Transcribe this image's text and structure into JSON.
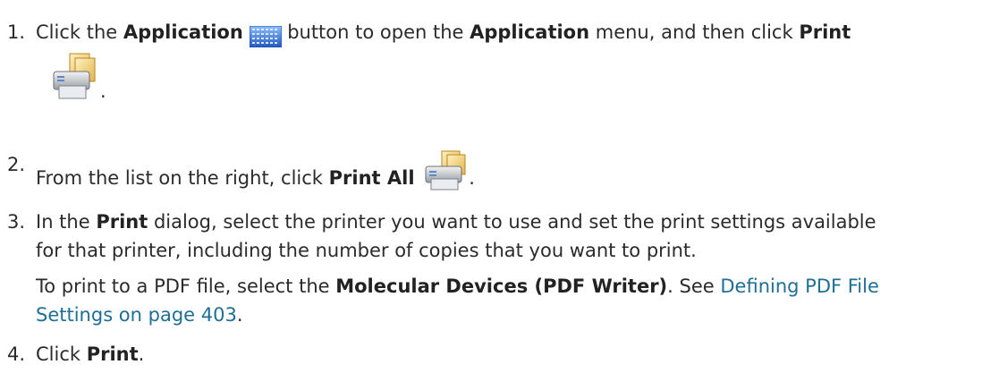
{
  "steps": [
    {
      "number": "1.",
      "t1": "Click the ",
      "b1": "Application",
      "t2": " button to open the ",
      "b2": "Application",
      "t3": " menu, and then click ",
      "b3": "Print",
      "t4": "."
    },
    {
      "number": "2.",
      "t1": "From the list on the right, click ",
      "b1": "Print All",
      "t2": "."
    },
    {
      "number": "3.",
      "t1": "In the ",
      "b1": "Print",
      "t2": " dialog, select the printer you want to use and set the print settings available",
      "line2": "for that printer, including the number of copies that you want to print.",
      "note_t1": "To print to a PDF file, select the ",
      "note_b1": "Molecular Devices (PDF Writer)",
      "note_t2": ". See ",
      "link_line1": "Defining PDF File",
      "link_line2": "Settings on page 403",
      "note_t3": "."
    },
    {
      "number": "4.",
      "t1": "Click ",
      "b1": "Print",
      "t2": "."
    }
  ],
  "icons": {
    "application": "application-grid-icon",
    "print": "printer-icon",
    "print_all": "print-all-icon"
  },
  "colors": {
    "text": "#2b2b2b",
    "link": "#1f6e96",
    "app_icon": "#2f6fd6"
  }
}
